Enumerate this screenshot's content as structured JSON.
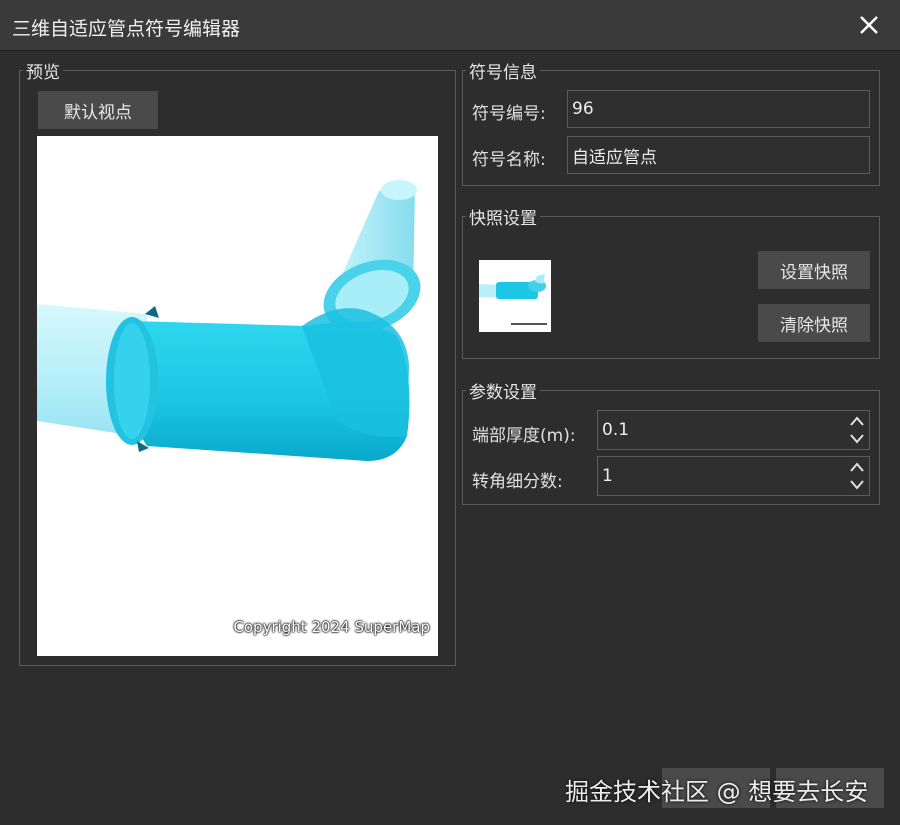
{
  "window": {
    "title": "三维自适应管点符号编辑器",
    "close_icon": "close-icon"
  },
  "preview": {
    "group_label": "预览",
    "default_view_button": "默认视点",
    "copyright": "Copyright 2024 SuperMap"
  },
  "symbol_info": {
    "group_label": "符号信息",
    "id_label": "符号编号:",
    "id_value": "96",
    "name_label": "符号名称:",
    "name_value": "自适应管点"
  },
  "snapshot": {
    "group_label": "快照设置",
    "set_button": "设置快照",
    "clear_button": "清除快照"
  },
  "params": {
    "group_label": "参数设置",
    "thickness_label": "端部厚度(m):",
    "thickness_value": "0.1",
    "subdivision_label": "转角细分数:",
    "subdivision_value": "1"
  },
  "footer": {
    "watermark": "掘金技术社区 @ 想要去长安"
  },
  "colors": {
    "pipe_light": "#b8f2fb",
    "pipe_main": "#1cc6e4",
    "pipe_dark": "#0aaed0"
  }
}
